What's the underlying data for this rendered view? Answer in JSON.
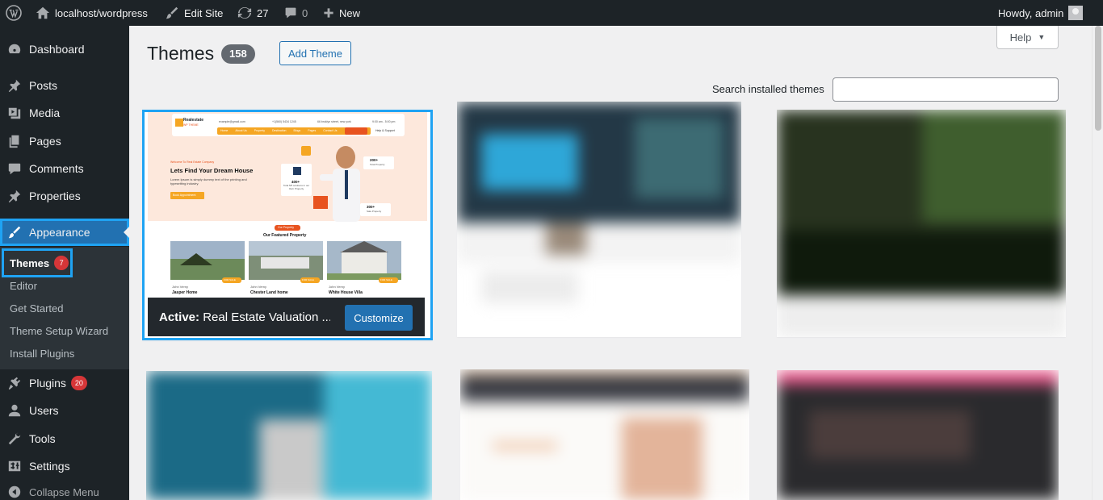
{
  "adminbar": {
    "site_name": "localhost/wordpress",
    "edit_site": "Edit Site",
    "updates_count": "27",
    "comments_count": "0",
    "new_label": "New",
    "howdy": "Howdy, admin"
  },
  "sidebar": {
    "items": [
      {
        "label": "Dashboard",
        "icon": "dashboard-icon"
      },
      {
        "label": "Posts",
        "icon": "pin-icon"
      },
      {
        "label": "Media",
        "icon": "media-icon"
      },
      {
        "label": "Pages",
        "icon": "pages-icon"
      },
      {
        "label": "Comments",
        "icon": "comments-icon"
      },
      {
        "label": "Properties",
        "icon": "pin-icon"
      },
      {
        "label": "Appearance",
        "icon": "appearance-icon"
      },
      {
        "label": "Plugins",
        "icon": "plugins-icon",
        "badge": "20"
      },
      {
        "label": "Users",
        "icon": "users-icon"
      },
      {
        "label": "Tools",
        "icon": "tools-icon"
      },
      {
        "label": "Settings",
        "icon": "settings-icon"
      },
      {
        "label": "Collapse Menu",
        "icon": "collapse-icon"
      }
    ],
    "submenu": [
      {
        "label": "Themes",
        "badge": "7"
      },
      {
        "label": "Editor"
      },
      {
        "label": "Get Started"
      },
      {
        "label": "Theme Setup Wizard"
      },
      {
        "label": "Install Plugins"
      }
    ]
  },
  "main": {
    "title": "Themes",
    "theme_count": "158",
    "add_theme": "Add Theme",
    "help": "Help",
    "search_label": "Search installed themes",
    "search_value": "",
    "active_theme": {
      "active_prefix": "Active:",
      "name": "Real Estate Valuation ...",
      "customize": "Customize"
    },
    "preview": {
      "logo_title": "Realestate",
      "logo_sub": "WP THEME",
      "email": "example@gmail.com",
      "phone": "+1(560) 5434 1245",
      "address": "66 broklyn street, new york",
      "hours": "9:00 am - 5:00 pm",
      "nav": [
        "Home",
        "About Us",
        "Property",
        "Destination",
        "Blogs",
        "Pages",
        "Contact Us"
      ],
      "help_support": "Help & Support",
      "welcome": "Welcome To Real Estate Company",
      "hero_title": "Lets Find Your Dream House",
      "hero_text": "Lorem Ipsum is simply dummy text of the printing and typesetting industry.",
      "hero_button": "Book Appointment",
      "stat1_num": "200+",
      "stat1_label": "Total Property",
      "stat2_num": "400+",
      "stat2_label": "Total 5/5 solutions in our Own Property",
      "stat3_num": "300+",
      "stat3_label": "Sale Property",
      "pill": "Our Property",
      "featured_title": "Our Featured Property",
      "cards": [
        {
          "name": "Jasper Home",
          "agent": "John Verny",
          "tag": "FOR SALE"
        },
        {
          "name": "Chester Land home",
          "agent": "John Verny",
          "tag": "FOR SALE"
        },
        {
          "name": "White House Villa",
          "agent": "John Verny",
          "tag": "FOR SALE"
        }
      ]
    }
  },
  "colors": {
    "adminbar_bg": "#1d2327",
    "accent": "#2271b1",
    "highlight_outline": "#1fa3f3",
    "badge_red": "#d63638",
    "preview_orange": "#f5a623"
  }
}
